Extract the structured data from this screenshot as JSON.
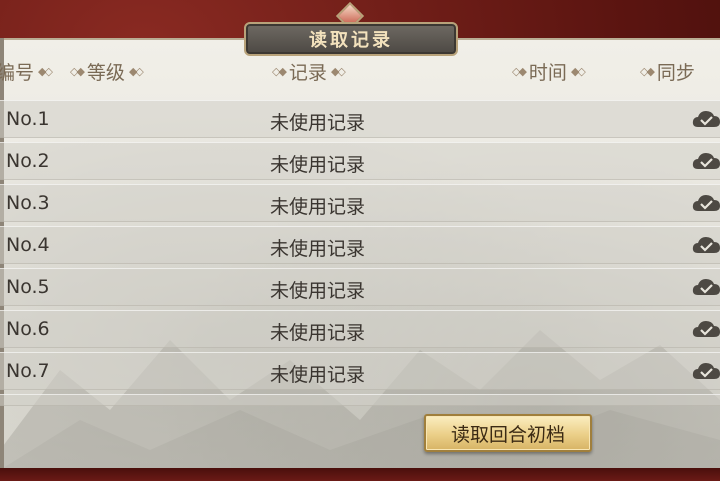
{
  "dialog": {
    "title": "读取记录"
  },
  "header": {
    "col_id": "编号",
    "col_level": "等级",
    "col_record": "记录",
    "col_time": "时间",
    "col_sync": "同步"
  },
  "rows": [
    {
      "num": "No.1",
      "record": "未使用记录"
    },
    {
      "num": "No.2",
      "record": "未使用记录"
    },
    {
      "num": "No.3",
      "record": "未使用记录"
    },
    {
      "num": "No.4",
      "record": "未使用记录"
    },
    {
      "num": "No.5",
      "record": "未使用记录"
    },
    {
      "num": "No.6",
      "record": "未使用记录"
    },
    {
      "num": "No.7",
      "record": "未使用记录"
    }
  ],
  "actions": {
    "load_turn_start": "读取回合初档"
  },
  "colors": {
    "frame_red": "#6b1a16",
    "panel_paper": "#ecebe4",
    "button_gold": "#ebcf88",
    "title_text": "#f3e2bd"
  },
  "icons": {
    "sync_status": "cloud-check-icon"
  }
}
